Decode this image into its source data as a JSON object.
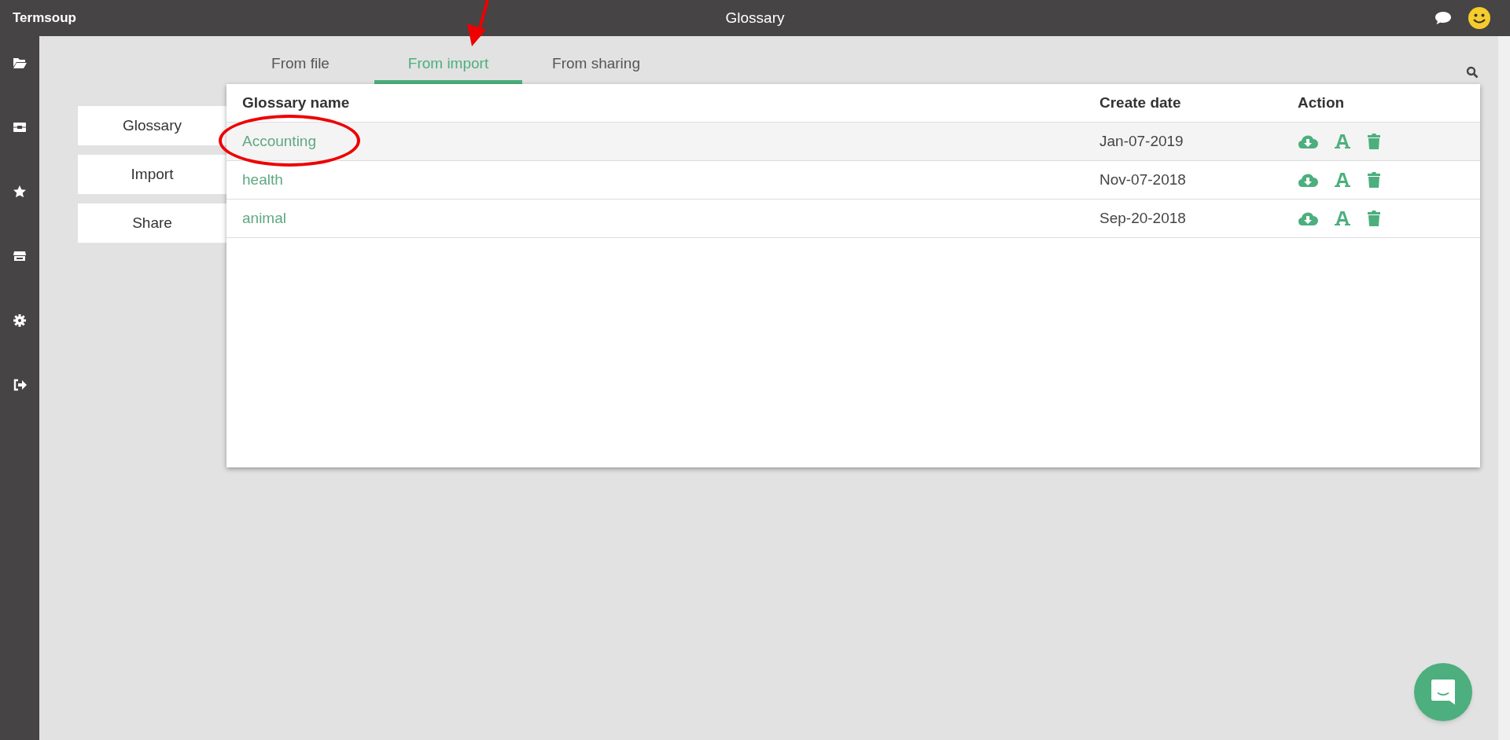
{
  "app": {
    "name": "Termsoup",
    "title": "Glossary"
  },
  "sidebar": {
    "items": [
      {
        "kind": "folder"
      },
      {
        "kind": "film"
      },
      {
        "kind": "star"
      },
      {
        "kind": "store"
      },
      {
        "kind": "gear"
      },
      {
        "kind": "logout"
      }
    ]
  },
  "menu": [
    "Glossary",
    "Import",
    "Share"
  ],
  "tabs": [
    {
      "label": "From file",
      "selected": false
    },
    {
      "label": "From import",
      "selected": true
    },
    {
      "label": "From sharing",
      "selected": false
    }
  ],
  "table": {
    "columns": [
      "Glossary name",
      "Create date",
      "Action"
    ],
    "rows": [
      {
        "name": "Accounting",
        "date": "Jan-07-2019",
        "highlighted": true,
        "annotated": true
      },
      {
        "name": "health",
        "date": "Nov-07-2018",
        "highlighted": false,
        "annotated": false
      },
      {
        "name": "animal",
        "date": "Sep-20-2018",
        "highlighted": false,
        "annotated": false
      }
    ]
  }
}
